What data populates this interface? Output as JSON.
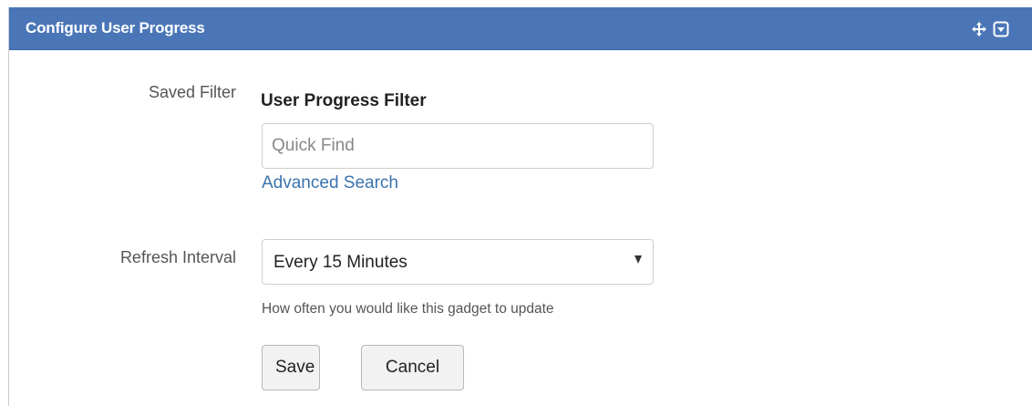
{
  "header": {
    "title": "Configure User Progress",
    "move_icon": "move-arrows-icon",
    "menu_icon": "dropdown-menu-icon",
    "background_color": "#4a76b8"
  },
  "form": {
    "saved_filter": {
      "label": "Saved Filter",
      "filter_name": "User Progress Filter",
      "quick_find_placeholder": "Quick Find",
      "quick_find_value": "",
      "advanced_search_link": "Advanced Search"
    },
    "refresh_interval": {
      "label": "Refresh Interval",
      "selected": "Every 15 Minutes",
      "help_text": "How often you would like this gadget to update"
    },
    "buttons": {
      "save": "Save",
      "cancel": "Cancel"
    }
  },
  "colors": {
    "link": "#3b73af",
    "header": "#4a76b8"
  }
}
